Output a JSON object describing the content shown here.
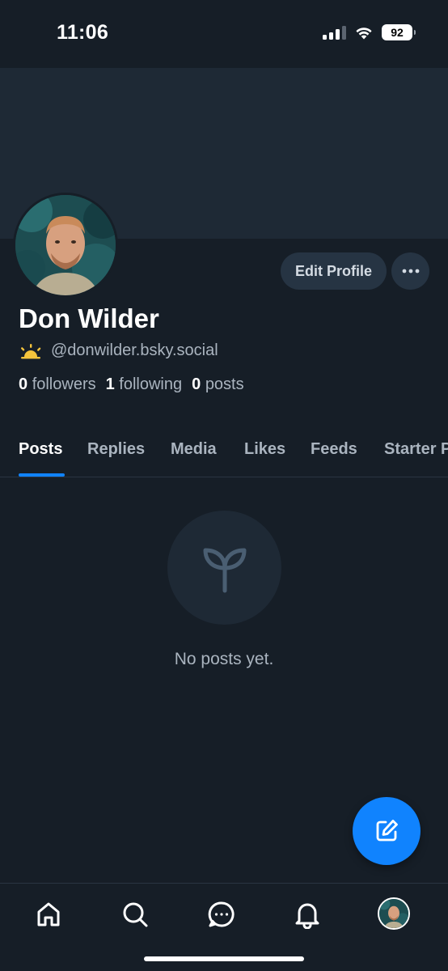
{
  "status_bar": {
    "time": "11:06",
    "battery": "92",
    "icons": [
      "signal-icon",
      "wifi-icon",
      "battery-icon"
    ]
  },
  "profile": {
    "display_name": "Don Wilder",
    "handle": "@donwilder.bsky.social",
    "handle_badge_icon": "sunrise-icon",
    "edit_label": "Edit Profile",
    "more_icon": "ellipsis-icon",
    "stats": {
      "followers_count": "0",
      "followers_label": "followers",
      "following_count": "1",
      "following_label": "following",
      "posts_count": "0",
      "posts_label": "posts"
    }
  },
  "tabs": [
    {
      "label": "Posts",
      "active": true
    },
    {
      "label": "Replies",
      "active": false
    },
    {
      "label": "Media",
      "active": false
    },
    {
      "label": "Likes",
      "active": false
    },
    {
      "label": "Feeds",
      "active": false
    },
    {
      "label": "Starter Packs",
      "active": false
    }
  ],
  "empty_state": {
    "icon": "seedling-icon",
    "message": "No posts yet."
  },
  "fab": {
    "icon": "compose-icon"
  },
  "bottom_nav": {
    "items": [
      "home-icon",
      "search-icon",
      "chat-icon",
      "bell-icon",
      "profile-avatar"
    ]
  },
  "colors": {
    "background": "#161e27",
    "banner": "#1e2935",
    "accent": "#1083fe",
    "button_bg": "#263443",
    "muted_text": "#aab4bf"
  }
}
